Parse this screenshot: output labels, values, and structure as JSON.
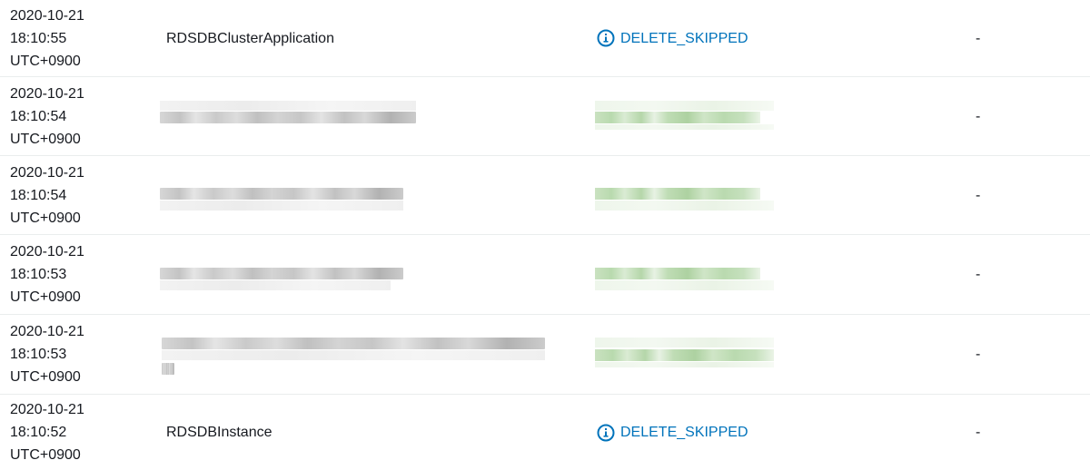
{
  "rows": [
    {
      "timestamp": "2020-10-21\n18:10:55\nUTC+0900",
      "logical_id": "RDSDBClusterApplication",
      "status": "DELETE_SKIPPED",
      "status_reason": "-"
    },
    {
      "timestamp": "2020-10-21\n18:10:54\nUTC+0900",
      "logical_id": "",
      "status": "",
      "status_reason": "-"
    },
    {
      "timestamp": "2020-10-21\n18:10:54\nUTC+0900",
      "logical_id": "",
      "status": "",
      "status_reason": "-"
    },
    {
      "timestamp": "2020-10-21\n18:10:53\nUTC+0900",
      "logical_id": "",
      "status": "",
      "status_reason": "-"
    },
    {
      "timestamp": "2020-10-21\n18:10:53\nUTC+0900",
      "logical_id": "",
      "status": "",
      "status_reason": "-"
    },
    {
      "timestamp": "2020-10-21\n18:10:52\nUTC+0900",
      "logical_id": "RDSDBInstance",
      "status": "DELETE_SKIPPED",
      "status_reason": "-"
    }
  ],
  "icons": {
    "status_icon": "info-circle-icon"
  },
  "colors": {
    "status_link": "#0073bb",
    "divider": "#eaeded",
    "text": "#16191f"
  }
}
